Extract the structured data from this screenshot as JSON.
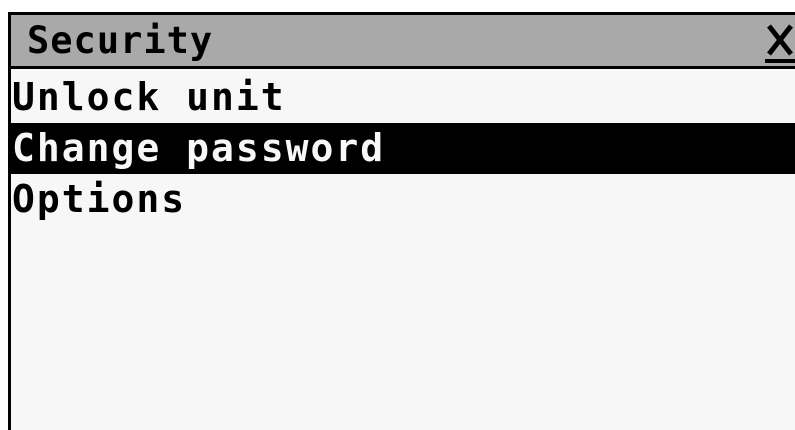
{
  "window": {
    "title": "Security",
    "close_icon": "close-x-icon"
  },
  "menu": {
    "items": [
      {
        "label": "Unlock unit",
        "selected": false
      },
      {
        "label": "Change password",
        "selected": true
      },
      {
        "label": "Options",
        "selected": false
      }
    ]
  },
  "colors": {
    "titlebar": "#a9a9a9",
    "background": "#f7f7f7",
    "selection": "#000000",
    "text": "#000000"
  }
}
